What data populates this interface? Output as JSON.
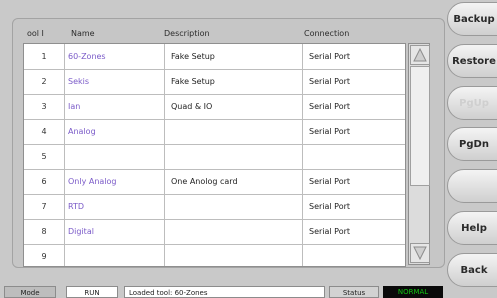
{
  "table": {
    "headers": [
      "ool I",
      "Name",
      "Description",
      "Connection"
    ],
    "rows": [
      {
        "num": "1",
        "name": "60-Zones",
        "desc": "Fake Setup",
        "conn": "Serial Port"
      },
      {
        "num": "2",
        "name": "Sekis",
        "desc": "Fake Setup",
        "conn": "Serial Port"
      },
      {
        "num": "3",
        "name": "Ian",
        "desc": "Quad & IO",
        "conn": "Serial Port"
      },
      {
        "num": "4",
        "name": "Analog",
        "desc": "",
        "conn": "Serial Port"
      },
      {
        "num": "5",
        "name": "",
        "desc": "",
        "conn": ""
      },
      {
        "num": "6",
        "name": "Only Analog",
        "desc": "One Anolog card",
        "conn": "Serial Port"
      },
      {
        "num": "7",
        "name": "RTD",
        "desc": "",
        "conn": "Serial Port"
      },
      {
        "num": "8",
        "name": "Digital",
        "desc": "",
        "conn": "Serial Port"
      },
      {
        "num": "9",
        "name": "",
        "desc": "",
        "conn": ""
      }
    ]
  },
  "sidebar": {
    "buttons": [
      {
        "label": "Backup",
        "enabled": true
      },
      {
        "label": "Restore",
        "enabled": true
      },
      {
        "label": "PgUp",
        "enabled": false
      },
      {
        "label": "PgDn",
        "enabled": true
      },
      {
        "label": "",
        "enabled": false
      },
      {
        "label": "Help",
        "enabled": true
      },
      {
        "label": "Back",
        "enabled": true
      }
    ]
  },
  "status": {
    "mode_label": "Mode",
    "run_state": "RUN",
    "message": "Loaded tool: 60-Zones",
    "status_label": "Status",
    "status_value": "NORMAL"
  },
  "colors": {
    "name_link": "#7a5ac8",
    "status_ok": "#13c413"
  }
}
